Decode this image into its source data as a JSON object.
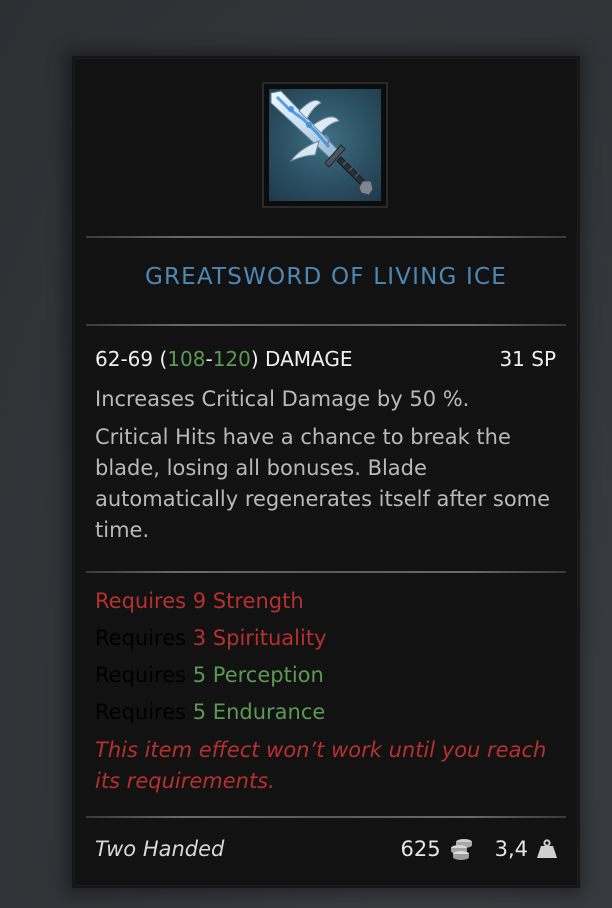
{
  "item": {
    "name": "GREATSWORD OF LIVING ICE",
    "icon": "greatsword-icon",
    "damage": {
      "base": "62-69",
      "open": " (",
      "bonus_min": "108",
      "dash": "-",
      "bonus_max": "120",
      "close": ")",
      "label": " DAMAGE"
    },
    "sp": "31 SP",
    "effects": [
      "Increases Critical Damage by 50 %.",
      "Critical Hits have a chance to break the blade, losing all bonuses. Blade automatically regenerates itself after some time."
    ],
    "requirements": [
      {
        "prefix": "Requires ",
        "value": "9 Strength",
        "met": false
      },
      {
        "prefix": "Requires ",
        "value": "3 Spirituality",
        "met": false
      },
      {
        "prefix": "Requires ",
        "value": "5 Perception",
        "met": true
      },
      {
        "prefix": "Requires ",
        "value": "5 Endurance",
        "met": true
      }
    ],
    "warning": "This item effect won’t work until you reach its requirements.",
    "handedness": "Two Handed",
    "price": "625",
    "price_icon": "coins-icon",
    "weight": "3,4",
    "weight_icon": "weight-icon"
  },
  "colors": {
    "title": "#4e88b5",
    "positive": "#5b9a52",
    "negative": "#b6312e",
    "text": "#b9b9b9",
    "panel": "#121213"
  }
}
